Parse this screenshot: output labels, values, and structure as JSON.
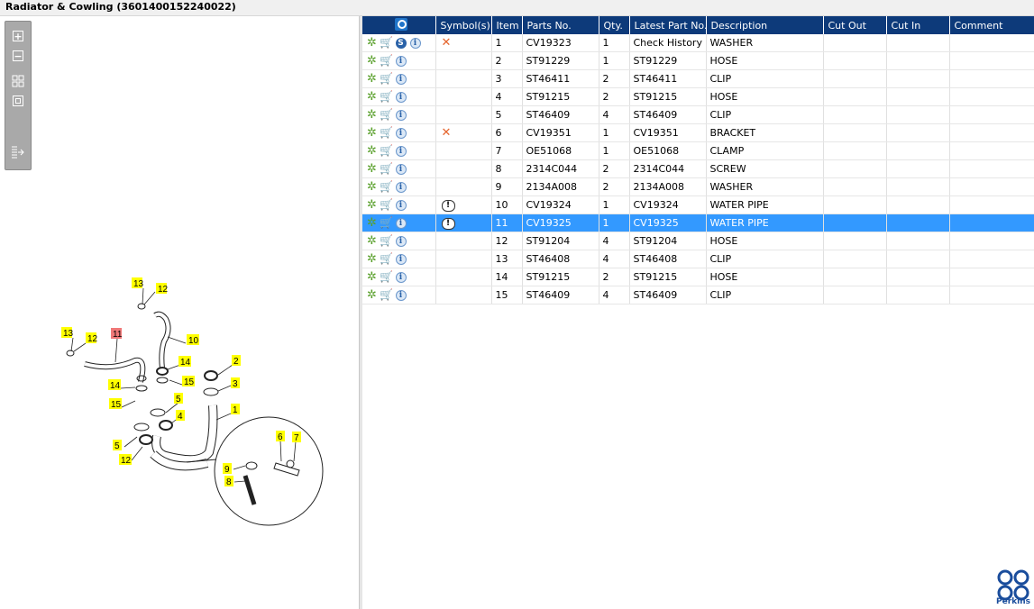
{
  "window": {
    "title": "Radiator & Cowling (3601400152240022)"
  },
  "colors": {
    "header_bg": "#0d3a7a",
    "selection": "#3399ff",
    "brand": "#1a4d9c"
  },
  "toolbar": {
    "icons": [
      "zoom-in-icon",
      "zoom-out-icon",
      "fit-all-icon",
      "fit-window-icon",
      "export-icon"
    ]
  },
  "diagram": {
    "callouts": [
      "13",
      "12",
      "13",
      "12",
      "11",
      "10",
      "14",
      "15",
      "2",
      "3",
      "14",
      "15",
      "5",
      "4",
      "1",
      "5",
      "12",
      "6",
      "7",
      "9",
      "8"
    ],
    "highlighted_callout": "11"
  },
  "table": {
    "columns": [
      "Symbol(s)",
      "Item",
      "Parts No.",
      "Qty.",
      "Latest Part No.",
      "Description",
      "Cut Out",
      "Cut In",
      "Comment"
    ],
    "rows": [
      {
        "symbol": "x",
        "sbadge": true,
        "item": "1",
        "part": "CV19323",
        "qty": "1",
        "latest": "Check History",
        "desc": "WASHER"
      },
      {
        "symbol": "",
        "sbadge": false,
        "item": "2",
        "part": "ST91229",
        "qty": "1",
        "latest": "ST91229",
        "desc": "HOSE"
      },
      {
        "symbol": "",
        "sbadge": false,
        "item": "3",
        "part": "ST46411",
        "qty": "2",
        "latest": "ST46411",
        "desc": "CLIP"
      },
      {
        "symbol": "",
        "sbadge": false,
        "item": "4",
        "part": "ST91215",
        "qty": "2",
        "latest": "ST91215",
        "desc": "HOSE"
      },
      {
        "symbol": "",
        "sbadge": false,
        "item": "5",
        "part": "ST46409",
        "qty": "4",
        "latest": "ST46409",
        "desc": "CLIP"
      },
      {
        "symbol": "x",
        "sbadge": false,
        "item": "6",
        "part": "CV19351",
        "qty": "1",
        "latest": "CV19351",
        "desc": "BRACKET"
      },
      {
        "symbol": "",
        "sbadge": false,
        "item": "7",
        "part": "OE51068",
        "qty": "1",
        "latest": "OE51068",
        "desc": "CLAMP"
      },
      {
        "symbol": "",
        "sbadge": false,
        "item": "8",
        "part": "2314C044",
        "qty": "2",
        "latest": "2314C044",
        "desc": "SCREW"
      },
      {
        "symbol": "",
        "sbadge": false,
        "item": "9",
        "part": "2134A008",
        "qty": "2",
        "latest": "2134A008",
        "desc": "WASHER"
      },
      {
        "symbol": "!",
        "sbadge": false,
        "item": "10",
        "part": "CV19324",
        "qty": "1",
        "latest": "CV19324",
        "desc": "WATER PIPE"
      },
      {
        "symbol": "!",
        "sbadge": false,
        "item": "11",
        "part": "CV19325",
        "qty": "1",
        "latest": "CV19325",
        "desc": "WATER PIPE",
        "selected": true
      },
      {
        "symbol": "",
        "sbadge": false,
        "item": "12",
        "part": "ST91204",
        "qty": "4",
        "latest": "ST91204",
        "desc": "HOSE"
      },
      {
        "symbol": "",
        "sbadge": false,
        "item": "13",
        "part": "ST46408",
        "qty": "4",
        "latest": "ST46408",
        "desc": "CLIP"
      },
      {
        "symbol": "",
        "sbadge": false,
        "item": "14",
        "part": "ST91215",
        "qty": "2",
        "latest": "ST91215",
        "desc": "HOSE"
      },
      {
        "symbol": "",
        "sbadge": false,
        "item": "15",
        "part": "ST46409",
        "qty": "4",
        "latest": "ST46409",
        "desc": "CLIP"
      }
    ]
  },
  "brand": {
    "name": "Perkins"
  }
}
